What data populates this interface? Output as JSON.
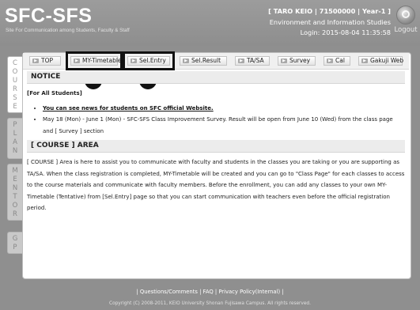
{
  "header": {
    "logo": "SFC-SFS",
    "tagline": "Site For Communication among Students, Faculty & Staff",
    "user_line": "[ TARO KEIO | 71500000 | Year-1 ]",
    "department": "Environment and Information Studies",
    "login_line": "Login: 2015-08-04 11:35:58",
    "logout_label": "Logout"
  },
  "side_tabs": [
    {
      "letters": [
        "C",
        "O",
        "U",
        "R",
        "S",
        "E"
      ],
      "active": true
    },
    {
      "letters": [
        "P",
        "L",
        "A",
        "N"
      ],
      "active": false
    },
    {
      "letters": [
        "M",
        "E",
        "N",
        "T",
        "O",
        "R"
      ],
      "active": false
    },
    {
      "letters": [
        "G",
        "P"
      ],
      "active": false
    }
  ],
  "nav": {
    "top": "TOP",
    "my_timetable": "MY-Timetable",
    "sel_entry": "Sel.Entry",
    "sel_result": "Sel.Result",
    "ta_sa": "TA/SA",
    "survey": "Survey",
    "cal": "Cal",
    "gakuji_web": "Gakuji Web"
  },
  "callouts": [
    "1",
    "2"
  ],
  "notice": {
    "heading": "NOTICE",
    "for_all": "[For All Students]",
    "items": [
      "You can see news for students on SFC official Website.",
      "May 18 (Mon) - June 1 (Mon) - SFC-SFS Class Improvement Survey. Result will be open from June 10 (Wed) from the class page and [ Survey ] section"
    ]
  },
  "course_area": {
    "heading": "[ COURSE ] AREA",
    "body": "[ COURSE ] Area is here to assist you to communicate with faculty and students in the classes you are taking or you are supporting as TA/SA. When the class registration is completed, MY-Timetable will be created and you can go to \"Class Page\" for each classes to access to the course materials and communicate with faculty members. Before the enrollment, you can add any classes to your own MY-Timetable (Tentative) from [Sel.Entry] page so that you can start communication with teachers even before the official registration period."
  },
  "footer": {
    "links": "| Questions/Comments | FAQ | Privacy Policy(Internal) |",
    "copyright": "Copyright (C) 2008-2011, KEIO University Shonan Fujisawa Campus. All rights reserved."
  }
}
